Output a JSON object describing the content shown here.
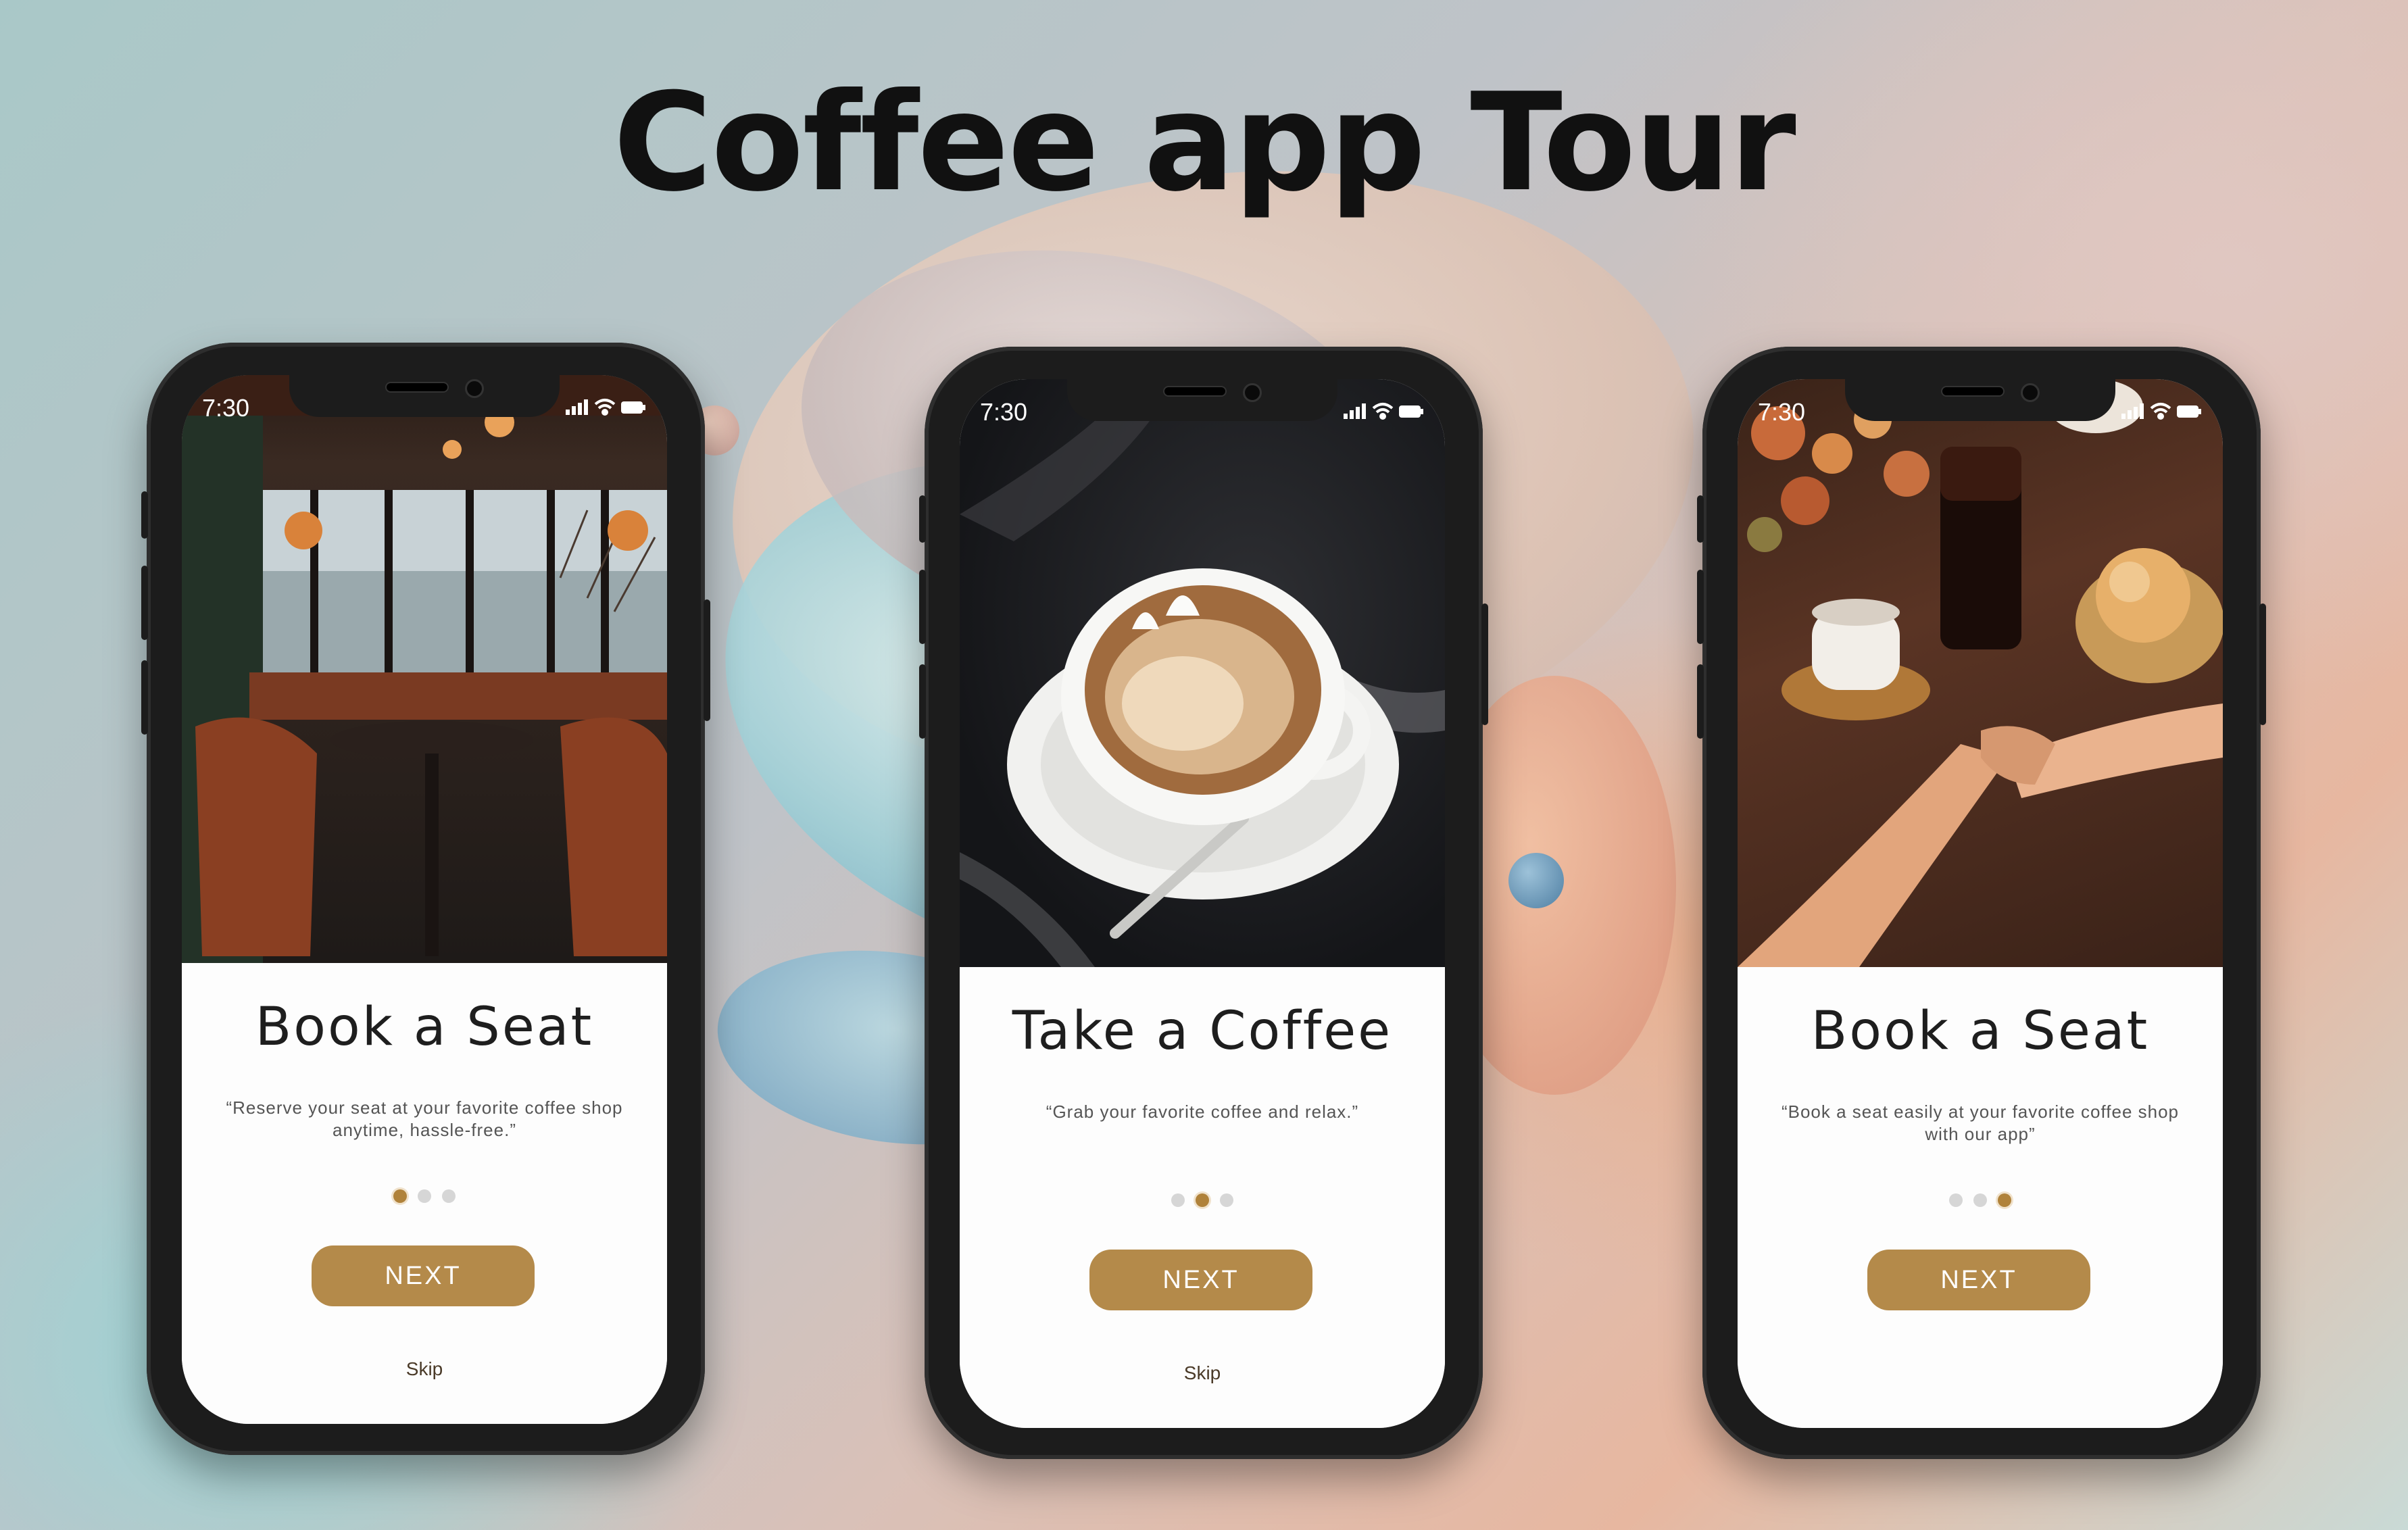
{
  "page": {
    "title": "Coffee app Tour"
  },
  "screens": [
    {
      "status_time": "7:30",
      "image": "cafe-interior-photo",
      "title": "Book a Seat",
      "description": "“Reserve your seat at your favorite coffee shop anytime, hassle-free.”",
      "dots": [
        "active",
        "inactive",
        "inactive"
      ],
      "button_label": "NEXT",
      "skip_label": "Skip"
    },
    {
      "status_time": "7:30",
      "image": "cappuccino-cup-photo",
      "title": "Take a Coffee",
      "description": "“Grab your favorite coffee and relax.”",
      "dots": [
        "inactive",
        "active",
        "inactive"
      ],
      "button_label": "NEXT",
      "skip_label": "Skip"
    },
    {
      "status_time": "7:30",
      "image": "holding-hands-cafe-photo",
      "title": "Book a Seat",
      "description": "“Book a seat easily at your favorite coffee shop with our app”",
      "dots": [
        "inactive",
        "inactive",
        "active"
      ],
      "button_label": "NEXT",
      "skip_label": ""
    }
  ],
  "colors": {
    "accent": "#b48a4a",
    "active_dot": "#b0823a",
    "inactive_dot": "#d6d6d6",
    "phone_frame": "#1c1c1c"
  }
}
